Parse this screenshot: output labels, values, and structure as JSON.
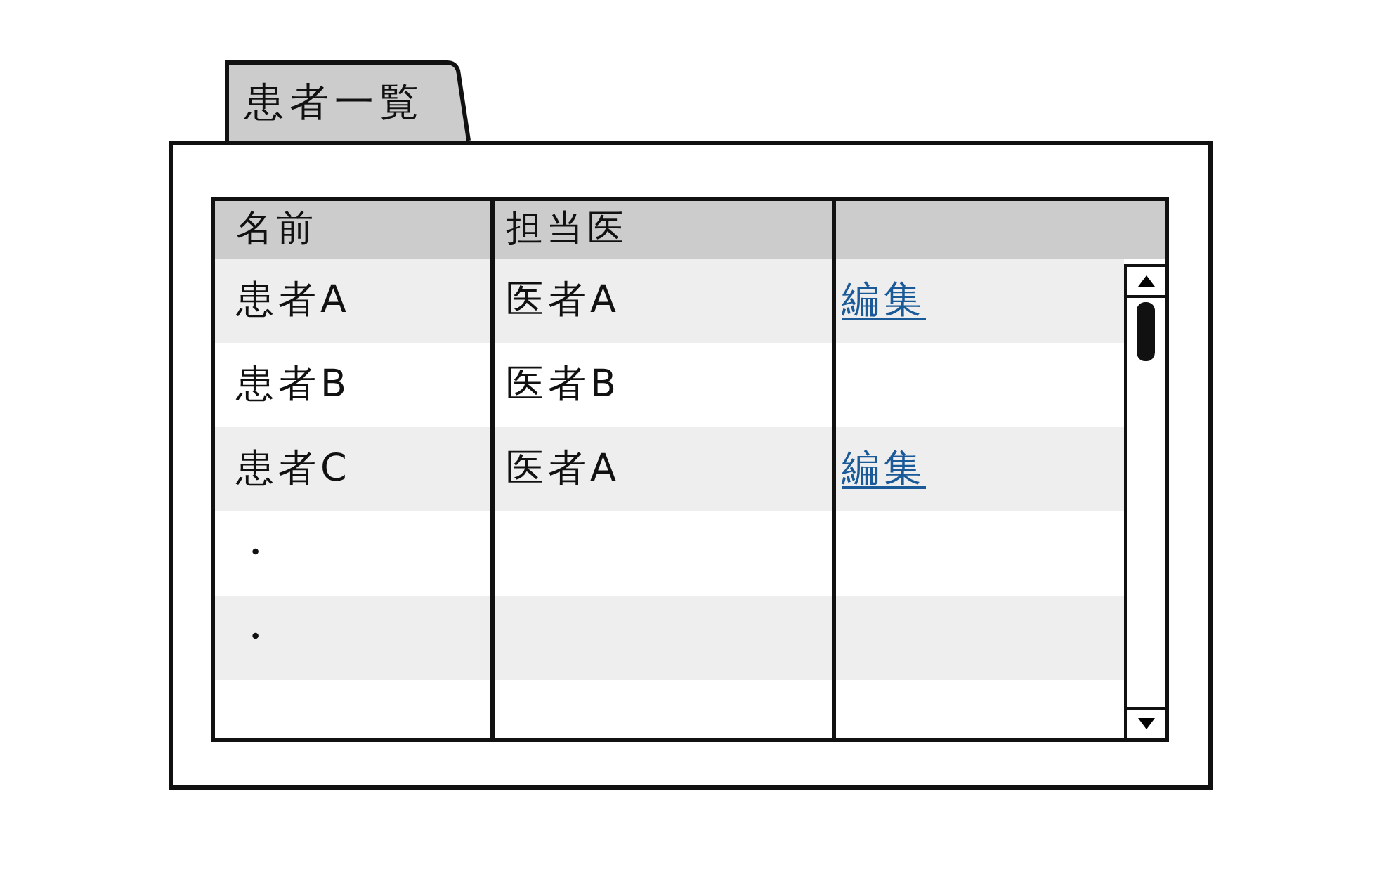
{
  "tab": {
    "label": "患者一覧",
    "selected": true
  },
  "table": {
    "columns": [
      "名前",
      "担当医"
    ],
    "rows": [
      {
        "name": "患者A",
        "doctor": "医者A",
        "column_3": "編集"
      },
      {
        "name": "患者B",
        "doctor": "医者B"
      },
      {
        "name": "患者C",
        "doctor": "医者A",
        "column_3": "編集"
      },
      {
        "name": "・"
      },
      {
        "name": "・"
      }
    ]
  }
}
